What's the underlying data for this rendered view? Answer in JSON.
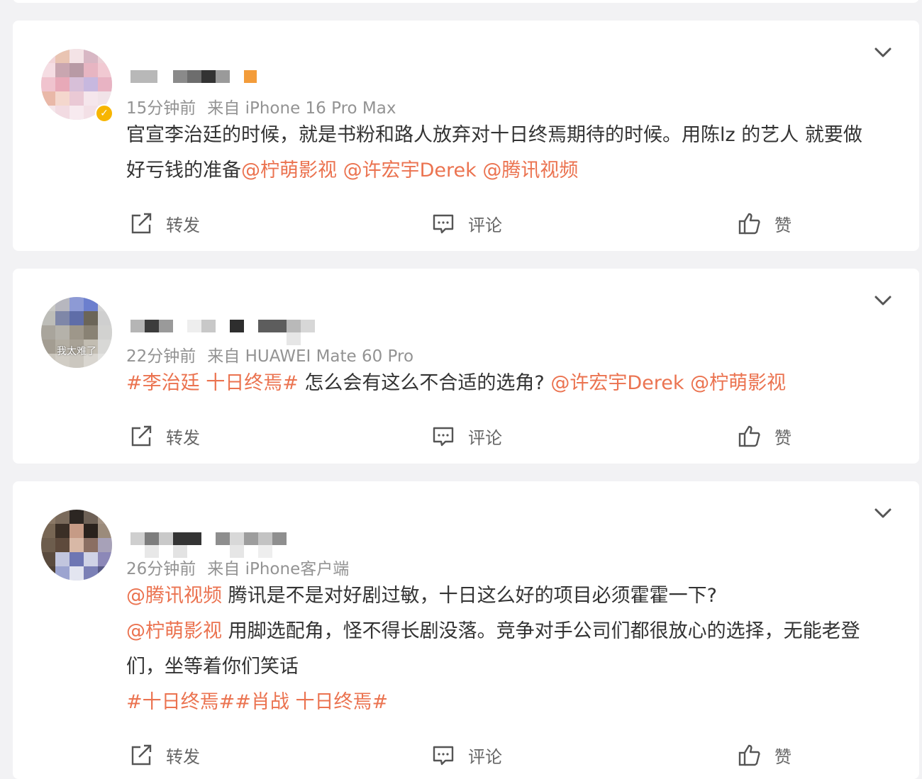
{
  "feed": [
    {
      "time": "15分钟前",
      "source": "来自 iPhone 16 Pro Max",
      "avatar_caption": "",
      "verified": true,
      "lines": [
        [
          {
            "text": "官宣李治廷的时候，就是书粉和路人放弃对十日终焉期待的时候。用陈lz 的艺人 就要做",
            "link": false
          }
        ],
        [
          {
            "text": "好亏钱的准备",
            "link": false
          },
          {
            "text": "@柠萌影视 @许宏宇Derek @腾讯视频",
            "link": true
          }
        ]
      ],
      "actions": {
        "repost": "转发",
        "comment": "评论",
        "like": "赞"
      }
    },
    {
      "time": "22分钟前",
      "source": "来自 HUAWEI Mate 60 Pro",
      "avatar_caption": "我太难了",
      "verified": false,
      "lines": [
        [
          {
            "text": "#李治廷 十日终焉#",
            "link": true
          },
          {
            "text": " 怎么会有这么不合适的选角? ",
            "link": false
          },
          {
            "text": "@许宏宇Derek @柠萌影视",
            "link": true
          }
        ]
      ],
      "actions": {
        "repost": "转发",
        "comment": "评论",
        "like": "赞"
      }
    },
    {
      "time": "26分钟前",
      "source": "来自 iPhone客户端",
      "avatar_caption": "",
      "verified": false,
      "lines": [
        [
          {
            "text": "@腾讯视频",
            "link": true
          },
          {
            "text": " 腾讯是不是对好剧过敏，十日这么好的项目必须霍霍一下?",
            "link": false
          }
        ],
        [
          {
            "text": "@柠萌影视",
            "link": true
          },
          {
            "text": " 用脚选配角，怪不得长剧没落。竞争对手公司们都很放心的选择，无能老登",
            "link": false
          }
        ],
        [
          {
            "text": "们，坐等着你们笑话",
            "link": false
          }
        ],
        [
          {
            "text": "#十日终焉##肖战 十日终焉#",
            "link": true
          }
        ]
      ],
      "actions": {
        "repost": "转发",
        "comment": "评论",
        "like": "赞"
      }
    }
  ],
  "colors": {
    "link": "#eb7350",
    "text": "#333333",
    "meta": "#939393",
    "background": "#f2f2f4",
    "verified_badge": "#f7b500"
  },
  "icons": {
    "repost": "share-icon",
    "comment": "comment-icon",
    "like": "thumbs-up-icon",
    "menu": "chevron-down-icon",
    "verified": "verified-badge-icon"
  }
}
